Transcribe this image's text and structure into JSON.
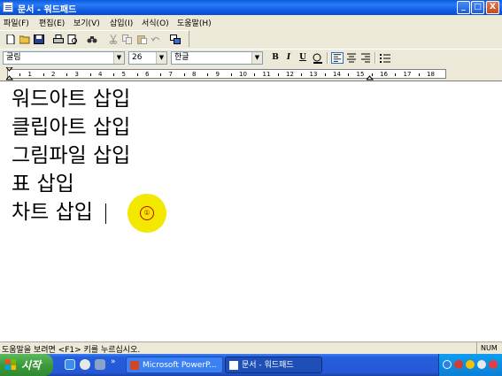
{
  "window": {
    "title": "문서 - 워드패드",
    "minimize": "_",
    "maximize": "□",
    "close": "X"
  },
  "menu": {
    "items": [
      {
        "label": "파일(F)"
      },
      {
        "label": "편집(E)"
      },
      {
        "label": "보기(V)"
      },
      {
        "label": "삽입(I)"
      },
      {
        "label": "서식(O)"
      },
      {
        "label": "도움말(H)"
      }
    ]
  },
  "toolbar": {
    "icons": [
      "new-icon",
      "open-icon",
      "save-icon",
      "print-icon",
      "print-preview-icon",
      "find-icon",
      "cut-icon",
      "copy-icon",
      "paste-icon",
      "undo-icon",
      "insert-object-icon"
    ]
  },
  "format": {
    "font_name": "굴림",
    "font_size": "26",
    "script": "한글",
    "bold": "B",
    "italic": "I",
    "underline": "U"
  },
  "ruler": {
    "labels": [
      "1",
      "2",
      "3",
      "4",
      "5",
      "6",
      "7",
      "8",
      "9",
      "10",
      "11",
      "12",
      "13",
      "14",
      "15",
      "16",
      "17",
      "18"
    ]
  },
  "document": {
    "lines": [
      "워드아트 삽입",
      "클립아트 삽입",
      "그림파일 삽입",
      "표 삽입",
      "차트 삽입"
    ],
    "ime_indicator": "①"
  },
  "status": {
    "help_text": "도움말을 보려면 <F1> 키를 누르십시오.",
    "num_lock": "NUM"
  },
  "taskbar": {
    "start_label": "시작",
    "tasks": [
      {
        "label": "Microsoft PowerP...",
        "active": false
      },
      {
        "label": "문서 - 워드패드",
        "active": true
      }
    ]
  },
  "colors": {
    "title_blue": "#0a5ae0",
    "start_green": "#3c9a3c",
    "ime_yellow": "#f2e800"
  }
}
